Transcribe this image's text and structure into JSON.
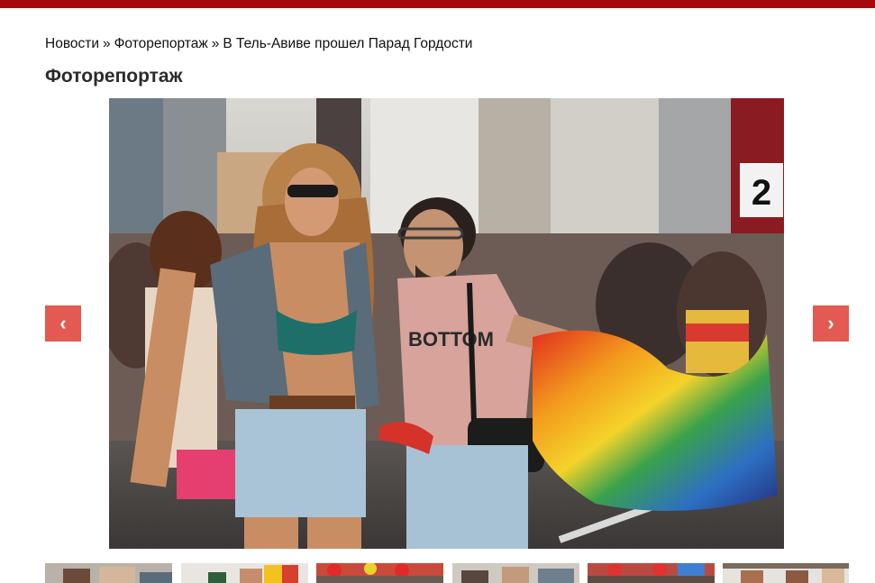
{
  "header": {
    "accent_color": "#a8070b"
  },
  "breadcrumb": {
    "items": [
      {
        "label": "Новости"
      },
      {
        "label": "Фоторепортаж"
      },
      {
        "label": "В Тель-Авиве прошел Парад Гордости"
      }
    ],
    "separator": "»"
  },
  "page": {
    "title": "Фоторепортаж"
  },
  "gallery": {
    "nav_color": "#e25a52",
    "prev_icon": "chevron-left-icon",
    "next_icon": "chevron-right-icon",
    "prev_glyph": "‹",
    "next_glyph": "›",
    "photo": {
      "shirt_text": "BOTTOM",
      "sign_text": "2"
    },
    "thumbnail_count": 6
  }
}
